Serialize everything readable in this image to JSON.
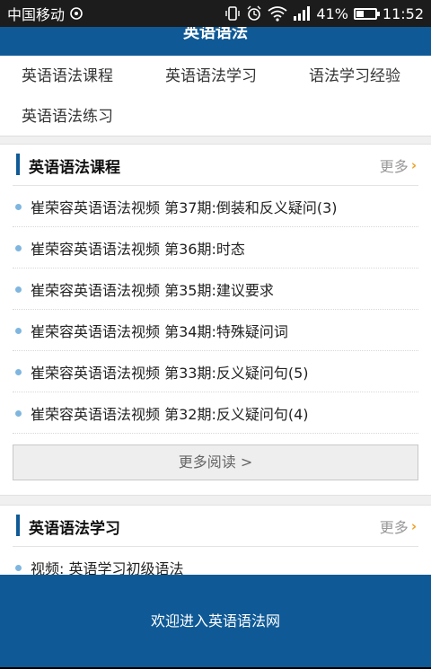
{
  "status_bar": {
    "carrier": "中国移动",
    "battery": "41%",
    "battery_level": 0.41,
    "time": "11:52"
  },
  "app_bar": {
    "title": "英语语法"
  },
  "nav": {
    "items": [
      {
        "label": "英语语法课程"
      },
      {
        "label": "英语语法学习"
      },
      {
        "label": "语法学习经验"
      },
      {
        "label": "英语语法练习"
      }
    ]
  },
  "section_courses": {
    "title": "英语语法课程",
    "more_label": "更多",
    "items": [
      {
        "text": "崔荣容英语语法视频 第37期:倒装和反义疑问(3)"
      },
      {
        "text": "崔荣容英语语法视频 第36期:时态"
      },
      {
        "text": "崔荣容英语语法视频 第35期:建议要求"
      },
      {
        "text": "崔荣容英语语法视频 第34期:特殊疑问词"
      },
      {
        "text": "崔荣容英语语法视频 第33期:反义疑问句(5)"
      },
      {
        "text": "崔荣容英语语法视频 第32期:反义疑问句(4)"
      }
    ],
    "read_more_label": "更多阅读 >"
  },
  "section_study": {
    "title": "英语语法学习",
    "more_label": "更多",
    "items": [
      {
        "text": "视频: 英语学习初级语法"
      }
    ]
  },
  "footer": {
    "text": "欢迎进入英语语法网"
  }
}
